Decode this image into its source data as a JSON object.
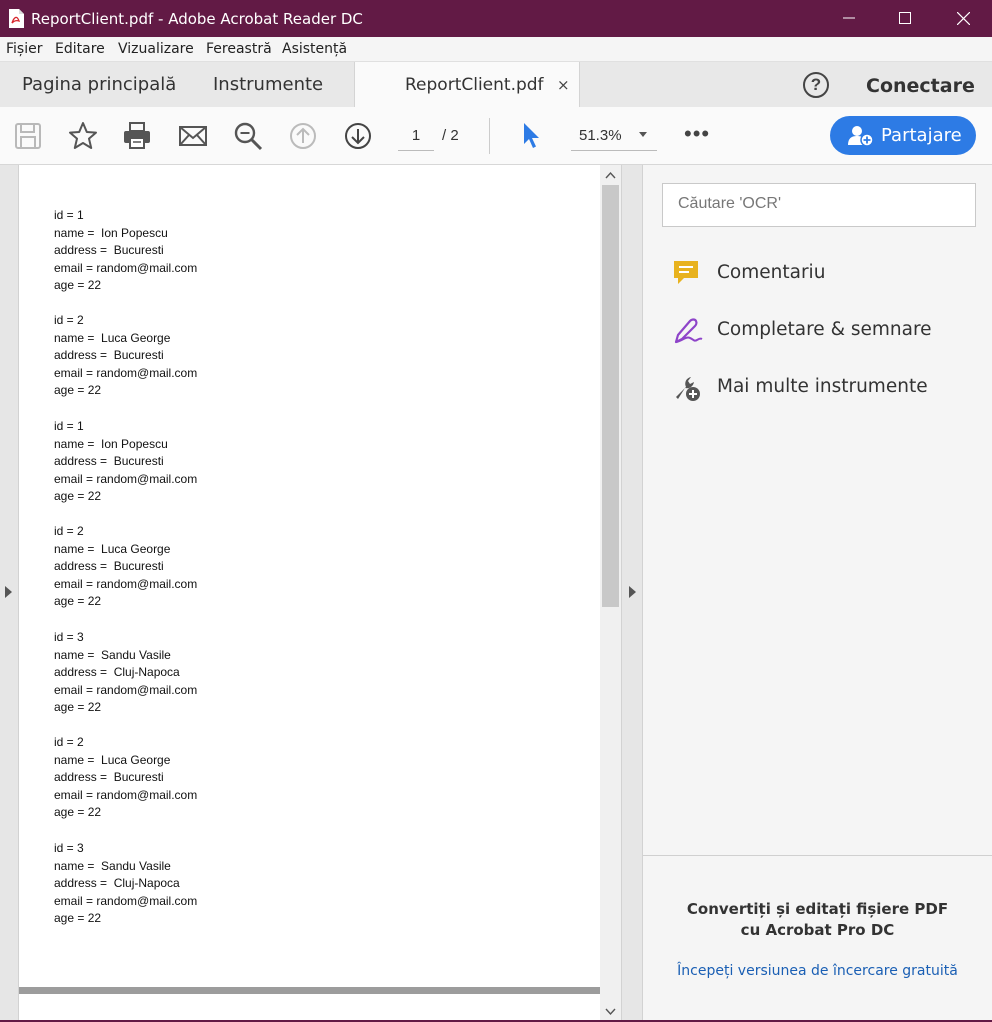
{
  "window": {
    "title": "ReportClient.pdf - Adobe Acrobat Reader DC"
  },
  "menu": [
    "Fișier",
    "Editare",
    "Vizualizare",
    "Fereastră",
    "Asistență"
  ],
  "tabs": {
    "home": "Pagina principală",
    "tools": "Instrumente",
    "document": "ReportClient.pdf",
    "close_glyph": "×"
  },
  "header": {
    "help_glyph": "?",
    "connect": "Conectare"
  },
  "toolbar": {
    "current_page": "1",
    "page_total": "/  2",
    "zoom": "51.3%",
    "more_glyph": "•••",
    "share_label": "Partajare"
  },
  "document": {
    "records": [
      {
        "id": "id = 1",
        "name": "name =  Ion Popescu",
        "address": "address =  Bucuresti",
        "email": "email = random@mail.com",
        "age": "age = 22"
      },
      {
        "id": "id = 2",
        "name": "name =  Luca George",
        "address": "address =  Bucuresti",
        "email": "email = random@mail.com",
        "age": "age = 22"
      },
      {
        "id": "id = 1",
        "name": "name =  Ion Popescu",
        "address": "address =  Bucuresti",
        "email": "email = random@mail.com",
        "age": "age = 22"
      },
      {
        "id": "id = 2",
        "name": "name =  Luca George",
        "address": "address =  Bucuresti",
        "email": "email = random@mail.com",
        "age": "age = 22"
      },
      {
        "id": "id = 3",
        "name": "name =  Sandu Vasile",
        "address": "address =  Cluj-Napoca",
        "email": "email = random@mail.com",
        "age": "age = 22"
      },
      {
        "id": "id = 2",
        "name": "name =  Luca George",
        "address": "address =  Bucuresti",
        "email": "email = random@mail.com",
        "age": "age = 22"
      },
      {
        "id": "id = 3",
        "name": "name =  Sandu Vasile",
        "address": "address =  Cluj-Napoca",
        "email": "email = random@mail.com",
        "age": "age = 22"
      }
    ]
  },
  "right_pane": {
    "search_placeholder": "Căutare 'OCR'",
    "tools": [
      {
        "label": "Comentariu",
        "icon": "comment-icon"
      },
      {
        "label": "Completare & semnare",
        "icon": "fill-sign-icon"
      },
      {
        "label": "Mai multe instrumente",
        "icon": "more-tools-icon"
      }
    ],
    "promo_line1": "Convertiți și editați fișiere PDF",
    "promo_line2": "cu Acrobat Pro DC",
    "promo_link": "Începeți versiunea de încercare gratuită"
  },
  "colors": {
    "titlebar": "#621a45",
    "accent": "#2d7be5",
    "comment_icon": "#e8b21e",
    "sign_icon": "#8e44c9"
  }
}
